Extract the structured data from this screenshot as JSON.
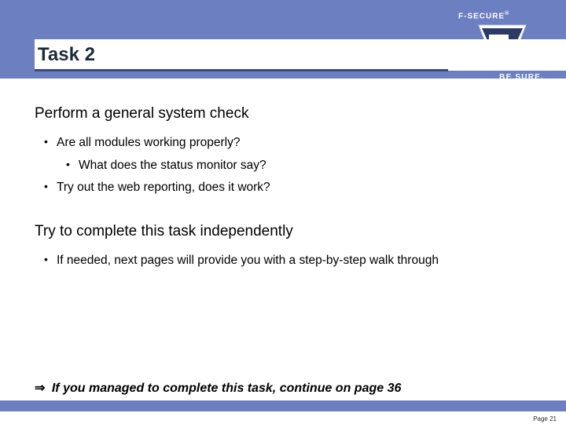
{
  "brand": {
    "name": "F-SECURE",
    "registered": "®",
    "tagline": "BE SURE."
  },
  "title": "Task 2",
  "section1": {
    "heading": "Perform a general system check",
    "bullets": {
      "b1": "Are all modules working properly?",
      "b1_sub1": "What does the status monitor say?",
      "b2": "Try out the web reporting, does it work?"
    }
  },
  "section2": {
    "heading": "Try to complete this task independently",
    "bullets": {
      "b1": "If needed, next pages will provide you with a step-by-step walk through"
    }
  },
  "footer": {
    "arrow": "⇒",
    "text": "If you managed to complete this task, continue on page 36"
  },
  "page": {
    "label": "Page 21"
  }
}
